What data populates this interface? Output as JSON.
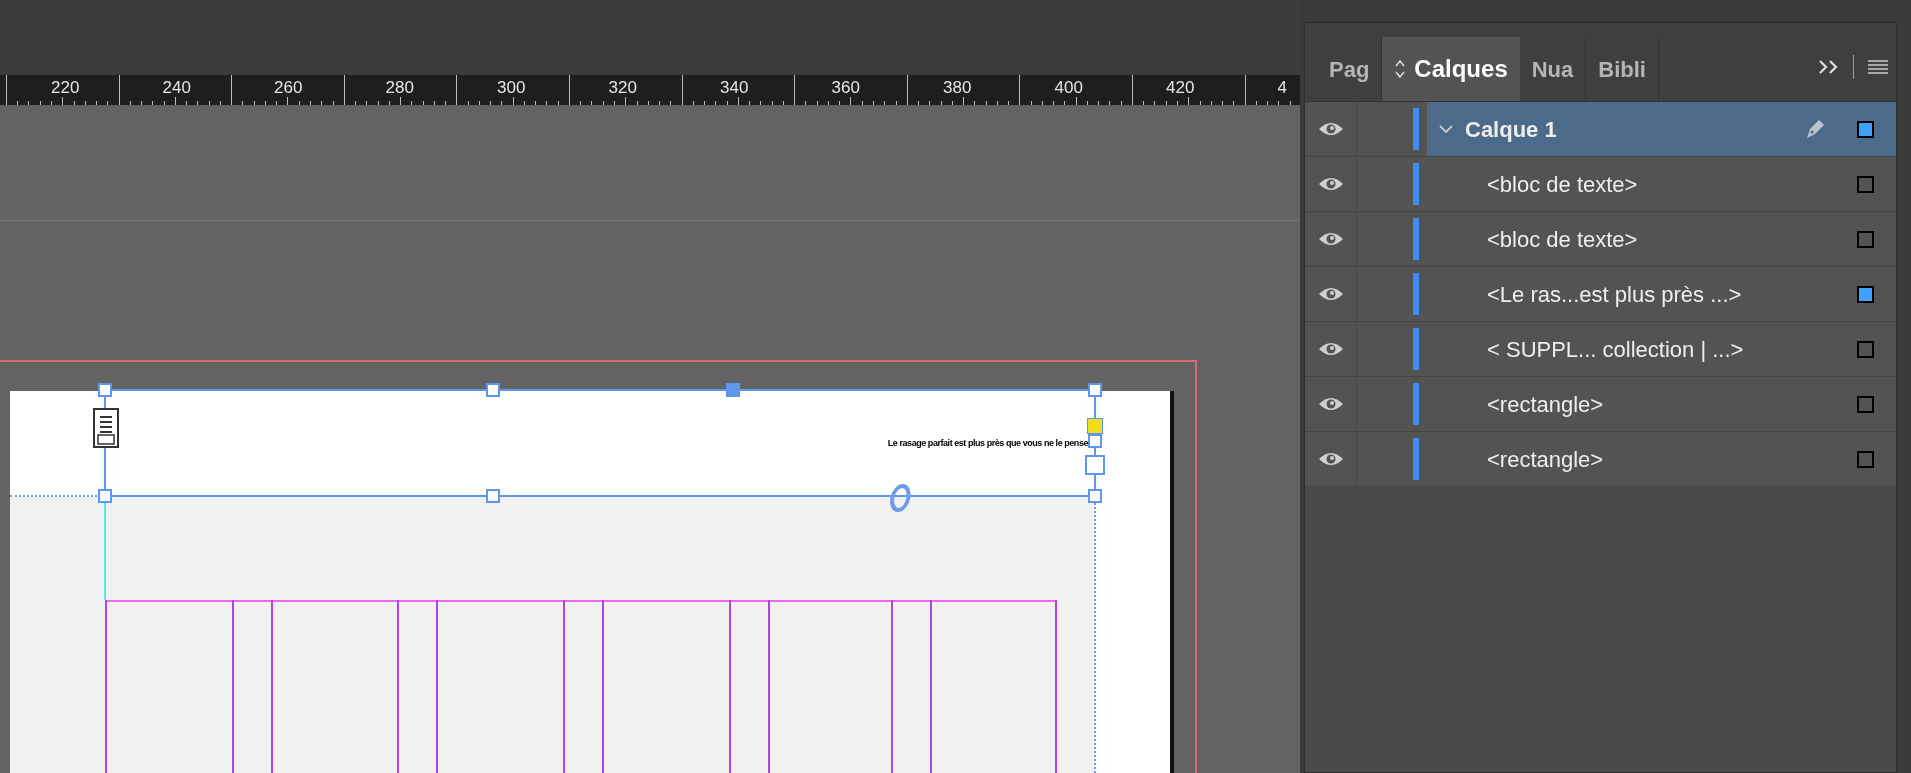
{
  "ruler": {
    "labels": [
      "220",
      "240",
      "260",
      "280",
      "300",
      "320",
      "340",
      "360",
      "380",
      "400",
      "420",
      "4"
    ]
  },
  "document": {
    "frame_text": "Le rasage parfait est plus près que vous ne le pense"
  },
  "panel": {
    "tabs": [
      {
        "label": "Pag",
        "selected": false
      },
      {
        "label": "Calques",
        "selected": true
      },
      {
        "label": "Nua",
        "selected": false
      },
      {
        "label": "Bibli",
        "selected": false
      }
    ],
    "layers": [
      {
        "name": "Calque 1",
        "visible": true,
        "active": true,
        "expanded": true,
        "selected": true,
        "children": [
          {
            "name": "<bloc de texte>",
            "visible": true,
            "selected": false
          },
          {
            "name": "<bloc de texte>",
            "visible": true,
            "selected": false
          },
          {
            "name": "<Le ras...est plus près ...>",
            "visible": true,
            "selected": true
          },
          {
            "name": "< SUPPL... collection | ...>",
            "visible": true,
            "selected": false
          },
          {
            "name": "<rectangle>",
            "visible": true,
            "selected": false
          },
          {
            "name": "<rectangle>",
            "visible": true,
            "selected": false
          }
        ]
      }
    ]
  }
}
